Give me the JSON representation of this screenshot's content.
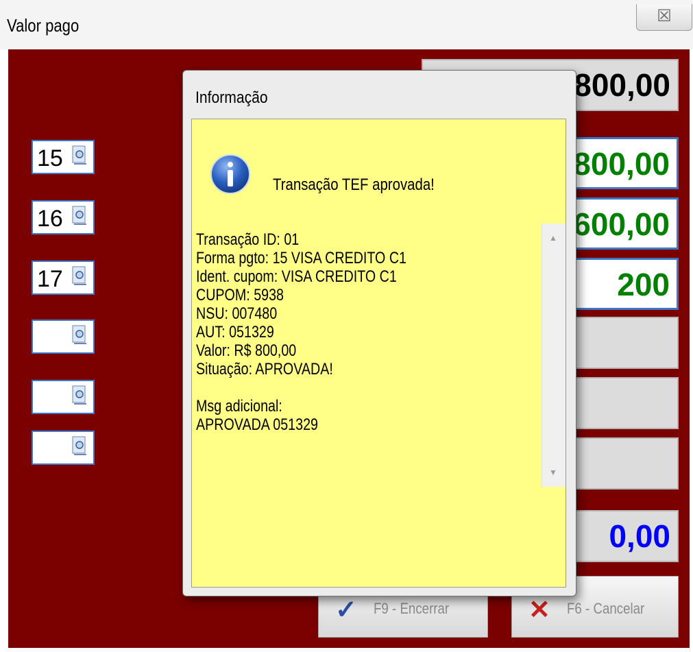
{
  "window": {
    "title": "Valor pago",
    "close_glyph": "☒"
  },
  "codes": [
    "15",
    "16",
    "17",
    "",
    "",
    ""
  ],
  "values": {
    "total": "800,00",
    "paid": "800,00",
    "line2": "600,00",
    "line3": "200",
    "remaining": "0,00"
  },
  "buttons": {
    "encerrar": "F9 - Encerrar",
    "cancelar": "F6 - Cancelar"
  },
  "dialog": {
    "title": "Informação",
    "headline": "Transação TEF aprovada!",
    "lines": [
      "Transação ID: 01",
      "Forma pgto: 15 VISA CREDITO C1",
      "Ident. cupom: VISA CREDITO C1",
      "CUPOM: 5938",
      "NSU: 007480",
      "AUT: 051329",
      "Valor: R$ 800,00",
      "Situação: APROVADA!",
      "",
      "Msg adicional:",
      "APROVADA 051329"
    ]
  },
  "colors": {
    "panel": "#7b0000",
    "green_value": "#008000",
    "blue_value": "#0000ff",
    "dialog_bg": "#ffff88"
  }
}
